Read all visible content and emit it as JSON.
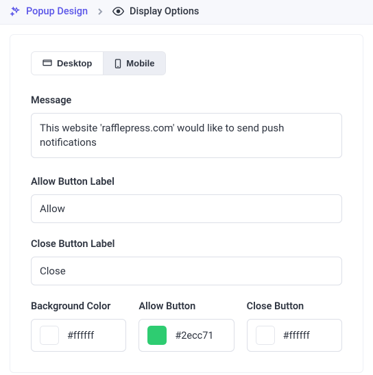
{
  "breadcrumb": {
    "parent": "Popup Design",
    "current": "Display Options"
  },
  "tabs": {
    "desktop": "Desktop",
    "mobile": "Mobile"
  },
  "labels": {
    "message": "Message",
    "allow_button_label": "Allow Button Label",
    "close_button_label": "Close Button Label",
    "background_color": "Background Color",
    "allow_button": "Allow Button",
    "close_button": "Close Button"
  },
  "values": {
    "message": "This website 'rafflepress.com' would like to send push notifications",
    "allow_label_value": "Allow",
    "close_label_value": "Close",
    "bg_hex": "#ffffff",
    "allow_hex": "#2ecc71",
    "close_hex": "#ffffff"
  },
  "colors": {
    "bg_swatch": "#ffffff",
    "allow_swatch": "#2ecc71",
    "close_swatch": "#ffffff"
  }
}
